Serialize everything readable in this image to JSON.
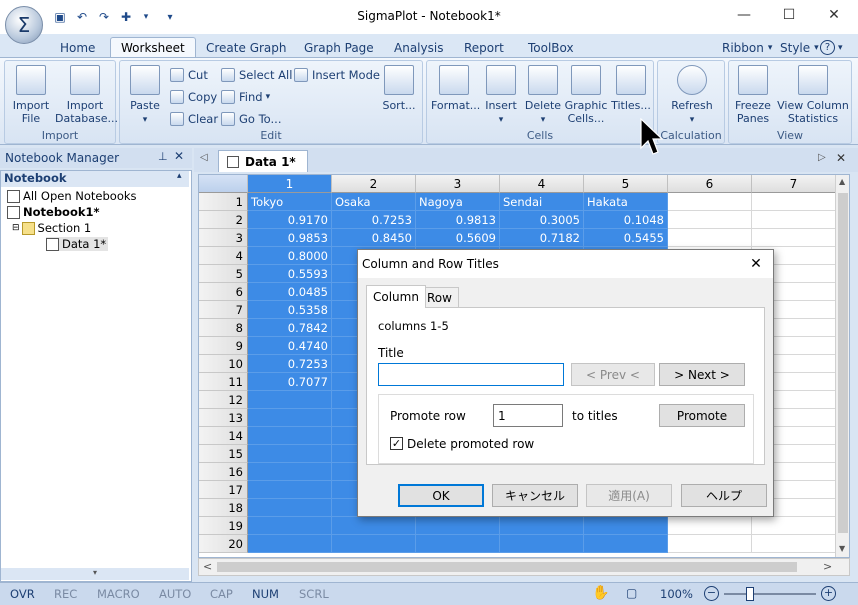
{
  "window": {
    "title": "SigmaPlot - Notebook1*",
    "app_orb": "Σ",
    "minimize_glyph": "—",
    "maximize_glyph": "☐",
    "close_glyph": "✕"
  },
  "ribbon_tabs": [
    "Home",
    "Worksheet",
    "Create Graph",
    "Graph Page",
    "Analysis",
    "Report",
    "ToolBox"
  ],
  "ribbon_right": {
    "ribbon": "Ribbon",
    "style": "Style",
    "help": "?"
  },
  "groups": {
    "import": {
      "label": "Import",
      "import_file": "Import File",
      "import_database": "Import Database..."
    },
    "edit": {
      "label": "Edit",
      "paste": "Paste",
      "cut": "Cut",
      "copy": "Copy",
      "clear": "Clear",
      "select_all": "Select All",
      "find": "Find",
      "goto": "Go To...",
      "insert_mode": "Insert Mode",
      "sort": "Sort..."
    },
    "cells": {
      "label": "Cells",
      "format": "Format...",
      "insert": "Insert",
      "delete": "Delete",
      "graphic_cells": "Graphic Cells...",
      "titles": "Titles..."
    },
    "calculation": {
      "label": "Calculation",
      "refresh": "Refresh"
    },
    "view": {
      "label": "View",
      "freeze_panes": "Freeze Panes",
      "view_column_statistics": "View Column Statistics"
    }
  },
  "notebook_manager": {
    "title": "Notebook Manager",
    "section_header": "Notebook",
    "tree": [
      "All Open Notebooks",
      "Notebook1*",
      "Section 1",
      "Data 1*"
    ]
  },
  "doc_tab": "Data 1*",
  "grid": {
    "col_headers": [
      "1",
      "2",
      "3",
      "4",
      "5",
      "6",
      "7"
    ],
    "col_titles": [
      "Tokyo",
      "Osaka",
      "Nagoya",
      "Sendai",
      "Hakata"
    ],
    "row_headers": [
      "1",
      "2",
      "3",
      "4",
      "5",
      "6",
      "7",
      "8",
      "9",
      "10",
      "11",
      "12",
      "13",
      "14",
      "15",
      "16",
      "17",
      "18",
      "19",
      "20"
    ],
    "rows": [
      [
        "0.9170",
        "0.7253",
        "0.9813",
        "0.3005",
        "0.1048"
      ],
      [
        "0.9853",
        "0.8450",
        "0.5609",
        "0.7182",
        "0.5455"
      ],
      [
        "0.8000",
        "",
        "",
        "",
        ""
      ],
      [
        "0.5593",
        "",
        "",
        "",
        ""
      ],
      [
        "0.0485",
        "",
        "",
        "",
        ""
      ],
      [
        "0.5358",
        "",
        "",
        "",
        ""
      ],
      [
        "0.7842",
        "",
        "",
        "",
        ""
      ],
      [
        "0.4740",
        "",
        "",
        "",
        ""
      ],
      [
        "0.7253",
        "",
        "",
        "",
        ""
      ],
      [
        "0.7077",
        "",
        "",
        "",
        ""
      ]
    ]
  },
  "status_bar": [
    "OVR",
    "REC",
    "MACRO",
    "AUTO",
    "CAP",
    "NUM",
    "SCRL"
  ],
  "zoom": "100%",
  "dialog": {
    "title": "Column and Row Titles",
    "tabs": [
      "Column",
      "Row"
    ],
    "range_label": "columns 1-5",
    "title_label": "Title",
    "title_value": "",
    "prev": "< Prev <",
    "next": "> Next >",
    "promote_row_label": "Promote row",
    "promote_row_value": "1",
    "to_titles": "to titles",
    "promote": "Promote",
    "delete_promoted": "Delete promoted row",
    "ok": "OK",
    "cancel": "キャンセル",
    "apply": "適用(A)",
    "help": "ヘルプ"
  }
}
